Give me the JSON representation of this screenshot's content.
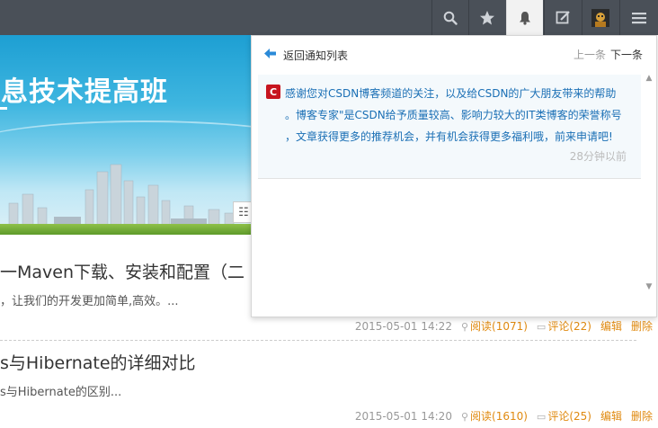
{
  "banner": {
    "title": "信息技术提高班"
  },
  "notification": {
    "back_label": "返回通知列表",
    "prev_label": "上一条",
    "next_label": "下一条",
    "logo_letter": "C",
    "message_lines": [
      "感谢您对CSDN博客频道的关注，以及给CSDN的广大朋友带来的帮助",
      "。博客专家\"是CSDN给予质量较高、影响力较大的IT类博客的荣誉称号",
      "，文章获得更多的推荐机会，并有机会获得更多福利哦，前来申请吧!"
    ],
    "time": "28分钟以前"
  },
  "articles": [
    {
      "title": "一Maven下载、安装和配置（二",
      "summary": "，让我们的开发更加简单,高效。...",
      "date": "2015-05-01 14:22",
      "read": "阅读(1071)",
      "comment": "评论(22)",
      "edit": "编辑",
      "delete": "删除"
    },
    {
      "title": "s与Hibernate的详细对比",
      "summary": "s与Hibernate的区别...",
      "date": "2015-05-01 14:20",
      "read": "阅读(1610)",
      "comment": "评论(25)",
      "edit": "编辑",
      "delete": "删除"
    }
  ],
  "icons": {
    "topbar": [
      "search-icon",
      "star-icon",
      "bell-icon",
      "edit-icon",
      "avatar",
      "menu-icon"
    ]
  },
  "colors": {
    "topbar": "#4a5058",
    "link": "#e08a10",
    "notice_text": "#1a6fb5",
    "csdn_red": "#c7151f"
  }
}
